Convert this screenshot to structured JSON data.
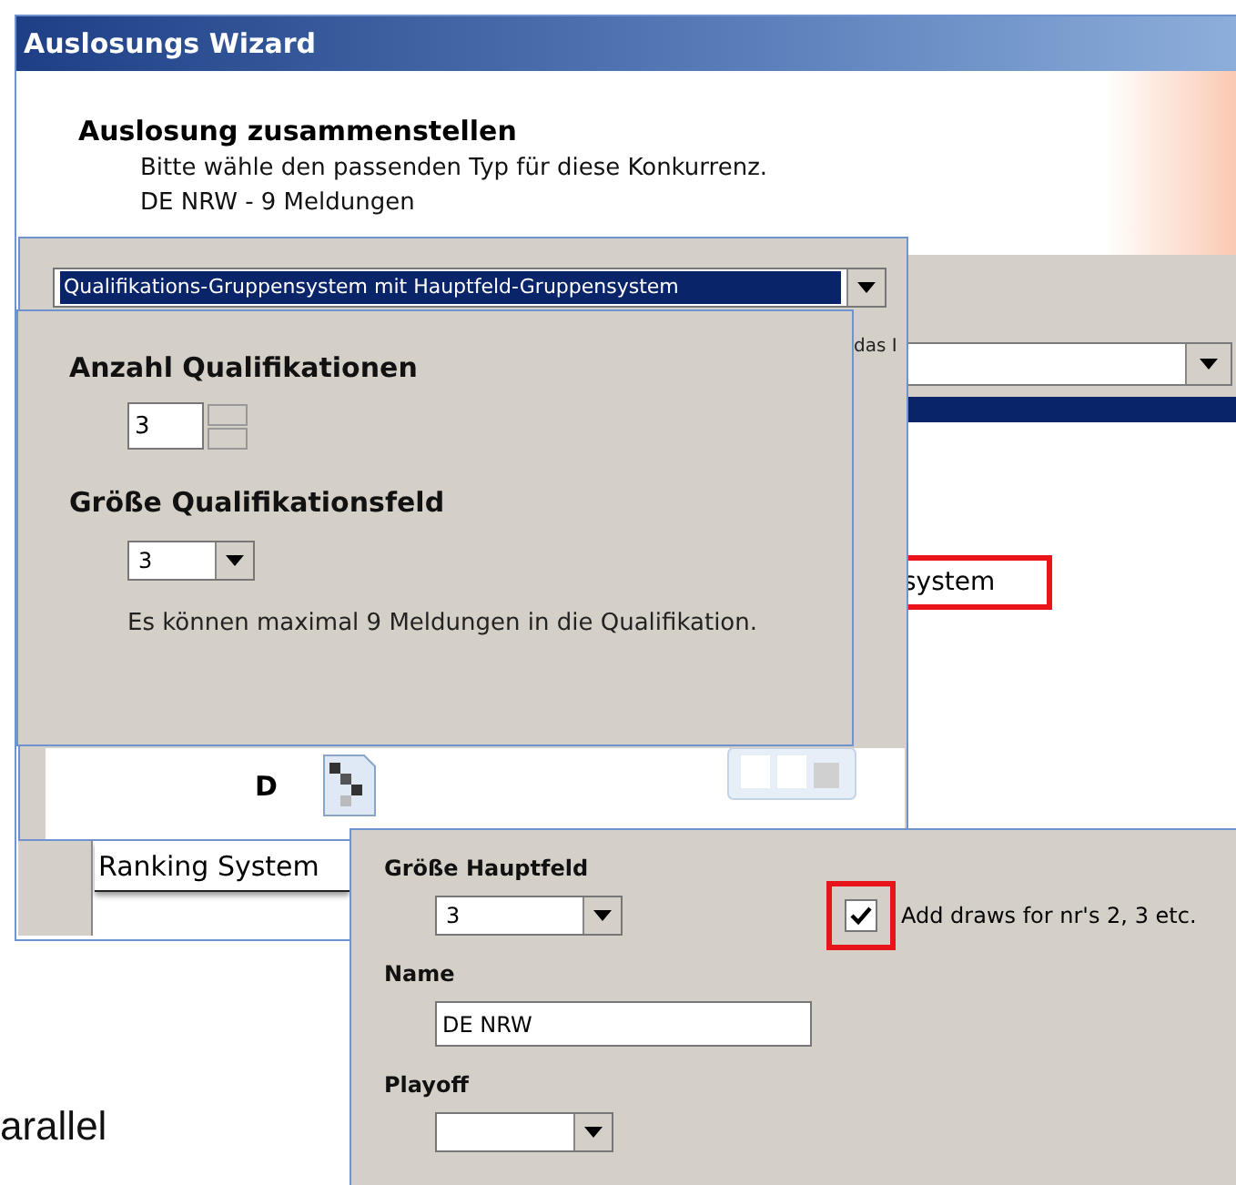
{
  "wizard": {
    "title": "Auslosungs Wizard",
    "heading": "Auslosung zusammenstellen",
    "subtitle": "Bitte wähle den passenden Typ für diese Konkurrenz.",
    "entry_info": "DE NRW - 9 Meldungen",
    "hint_fragment": "das I",
    "highlighted_fragment": "system"
  },
  "type_panel": {
    "draw_type": "Qualifikations-Gruppensystem mit Hauptfeld-Gruppensystem",
    "qualifications_label": "Anzahl Qualifikationen",
    "qualifications_value": "3",
    "field_size_label": "Größe Qualifikationsfeld",
    "field_size_value": "3",
    "note": "Es können maximal 9 Meldungen in die Qualifikation.",
    "letter": "D"
  },
  "ranking_label": "Ranking System",
  "main_panel": {
    "size_label": "Größe Hauptfeld",
    "size_value": "3",
    "add_draws": {
      "label": "Add draws for nr's 2, 3 etc.",
      "checked": true
    },
    "name_label": "Name",
    "name_value": "DE NRW",
    "playoff_label": "Playoff"
  },
  "background_text": "arallel"
}
